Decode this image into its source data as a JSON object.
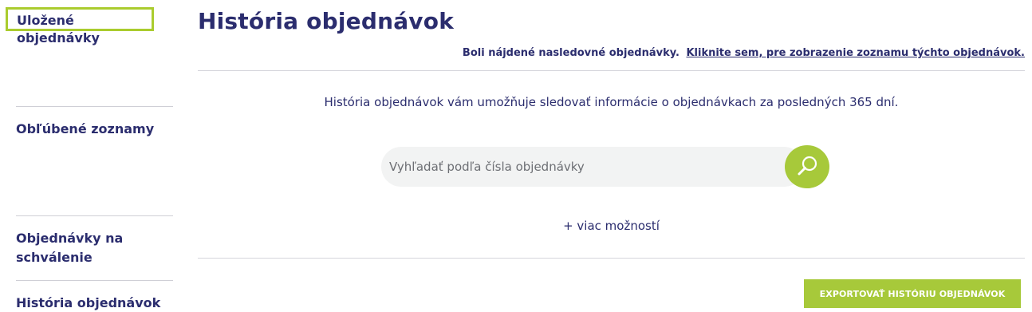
{
  "sidebar": {
    "items": [
      {
        "label": "Uložené objednávky"
      },
      {
        "label": "Obľúbené zoznamy"
      },
      {
        "label": "Objednávky na schválenie"
      },
      {
        "label": "História objednávok"
      }
    ],
    "highlight_color": "#aacc2e"
  },
  "main": {
    "title": "História objednávok",
    "found_text": "Boli nájdené nasledovné objednávky.",
    "found_link": "Kliknite sem, pre zobrazenie zoznamu týchto objednávok.",
    "intro": "História objednávok vám umožňuje sledovať informácie o objednávkach za posledných 365 dní.",
    "search": {
      "placeholder": "Vyhľadať podľa čísla objednávky",
      "value": "",
      "button_icon": "search-icon"
    },
    "more_options": "+ viac možností",
    "export_label": "EXPORTOVAŤ HISTÓRIU OBJEDNÁVOK"
  },
  "colors": {
    "brand_text": "#2b2d6e",
    "accent_green": "#a7c93a",
    "input_bg": "#f2f3f3"
  }
}
